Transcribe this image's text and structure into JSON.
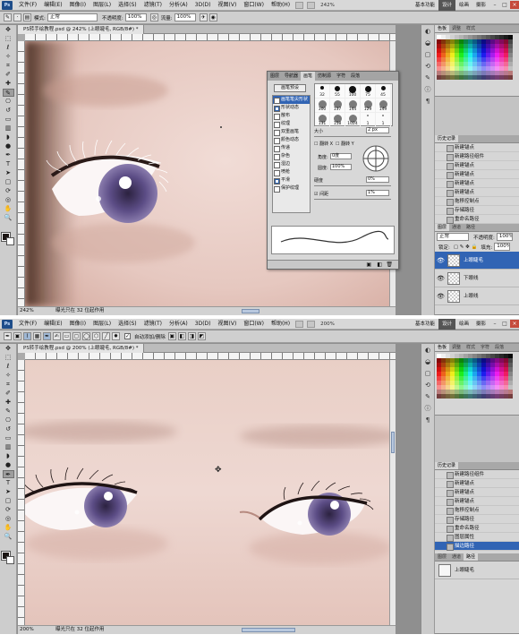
{
  "screen_a": {
    "menu": [
      "文件(F)",
      "编辑(E)",
      "图像(I)",
      "图层(L)",
      "选择(S)",
      "滤镜(T)",
      "分析(A)",
      "3D(D)",
      "视图(V)",
      "窗口(W)",
      "帮助(H)"
    ],
    "zoom_display": "242%",
    "workspaces": [
      "基本功能",
      "设计",
      "绘画",
      "摄影"
    ],
    "active_workspace": "设计",
    "options": {
      "mode_label": "模式:",
      "mode_value": "正常",
      "opacity_label": "不透明度:",
      "opacity_value": "100%",
      "flow_label": "流量:",
      "flow_value": "100%"
    },
    "doc_tab": "PS转手绘教程.psd @ 242% (上眼睫毛, RGB/8#) *",
    "status_zoom": "242%",
    "status_text": "曝光只在 32 位起作用",
    "brush_panel": {
      "tabs": [
        "图层",
        "导航器",
        "画笔",
        "仿制源",
        "字符",
        "段落"
      ],
      "active_tab": "画笔",
      "preset_button": "画笔预设",
      "options": [
        {
          "label": "画笔笔尖形状",
          "checked": false,
          "selected": true
        },
        {
          "label": "形状动态",
          "checked": true,
          "selected": false
        },
        {
          "label": "散布",
          "checked": false,
          "selected": false
        },
        {
          "label": "纹理",
          "checked": false,
          "selected": false
        },
        {
          "label": "双重画笔",
          "checked": false,
          "selected": false
        },
        {
          "label": "颜色动态",
          "checked": false,
          "selected": false
        },
        {
          "label": "传递",
          "checked": false,
          "selected": false
        },
        {
          "label": "杂色",
          "checked": false,
          "selected": false
        },
        {
          "label": "湿边",
          "checked": false,
          "selected": false
        },
        {
          "label": "喷枪",
          "checked": false,
          "selected": false
        },
        {
          "label": "平滑",
          "checked": true,
          "selected": false
        },
        {
          "label": "保护纹理",
          "checked": false,
          "selected": false
        }
      ],
      "brush_sizes": [
        "32",
        "55",
        "100",
        "75",
        "45",
        "300",
        "137",
        "144",
        "129",
        "149",
        "131",
        "158",
        "1024",
        "1",
        "1"
      ],
      "size_label": "大小",
      "size_value": "2 px",
      "flip_x": "翻转 X",
      "flip_y": "翻转 Y",
      "angle_label": "角度:",
      "angle_value": "0度",
      "roundness_label": "圆度:",
      "roundness_value": "100%",
      "hardness_label": "硬度",
      "hardness_value": "0%",
      "spacing_label": "间距",
      "spacing_value": "1%"
    },
    "swatches_tabs": [
      "色板",
      "调整",
      "样式"
    ],
    "history_title": "历史记录",
    "history": [
      "新建锚点",
      "新建路径组件",
      "新建锚点",
      "新建锚点",
      "新建锚点",
      "新建锚点",
      "拖移控制点",
      "存储路径",
      "重命名路径",
      "图层属性"
    ],
    "history_selected": 9,
    "layers_tabs": [
      "图层",
      "通道",
      "路径"
    ],
    "layers_blend": "正常",
    "layers_opacity_label": "不透明度:",
    "layers_opacity": "100%",
    "layers_lock_label": "锁定:",
    "layers_fill_label": "填充:",
    "layers_fill": "100%",
    "layers": [
      "上眼睫毛",
      "下眼线",
      "上眼线"
    ],
    "layers_selected": 0
  },
  "screen_b": {
    "menu": [
      "文件(F)",
      "编辑(E)",
      "图像(I)",
      "图层(L)",
      "选择(S)",
      "滤镜(T)",
      "分析(A)",
      "3D(D)",
      "视图(V)",
      "窗口(W)",
      "帮助(H)"
    ],
    "zoom_display": "200%",
    "workspaces": [
      "基本功能",
      "设计",
      "绘画",
      "摄影"
    ],
    "active_workspace": "设计",
    "options": {
      "auto_add_delete": "自动添加/删除"
    },
    "doc_tab": "PS转手绘教程.psd @ 200% (上眼睫毛, RGB/8#) *",
    "status_zoom": "200%",
    "status_text": "曝光只在 32 位起作用",
    "swatches_tabs": [
      "色板",
      "调整",
      "样式",
      "字符",
      "段落"
    ],
    "history_title": "历史记录",
    "history": [
      "新建路径组件",
      "新建锚点",
      "新建锚点",
      "新建锚点",
      "拖移控制点",
      "存储路径",
      "重命名路径",
      "图层属性",
      "描边路径"
    ],
    "history_selected": 8,
    "layers_tabs": [
      "图层",
      "通道",
      "路径"
    ],
    "paths": [
      "上眼睫毛"
    ]
  },
  "colors": {
    "selection_blue": "#3164b4",
    "skin": "#e8cfc8",
    "iris": "#5a4a7a",
    "ui_gray": "#d6d6d6"
  }
}
